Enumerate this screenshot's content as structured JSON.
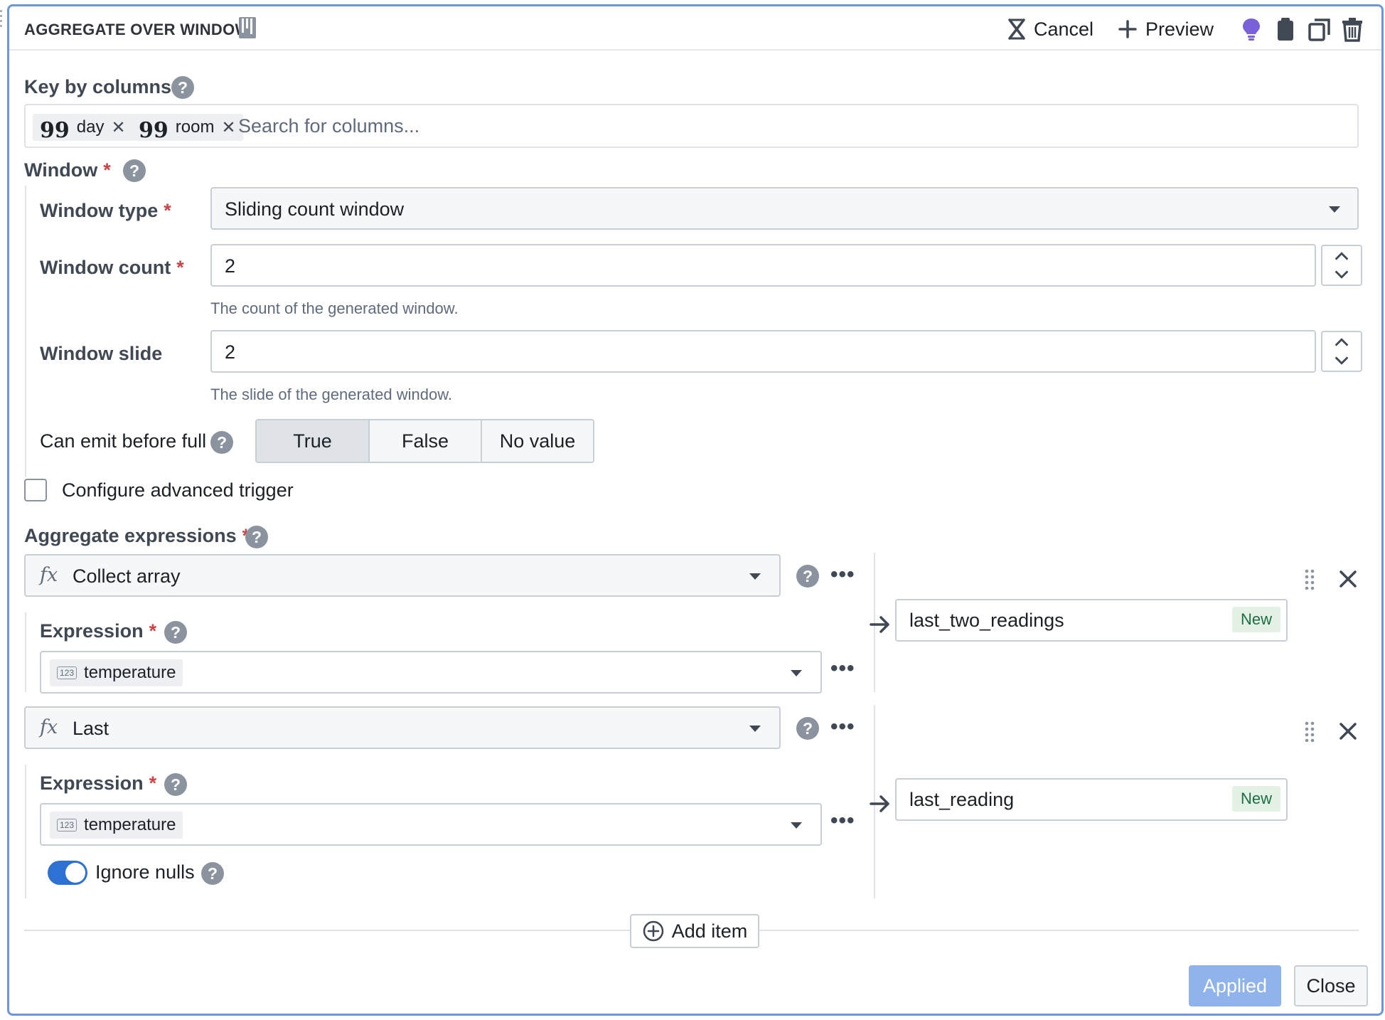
{
  "header": {
    "title": "AGGREGATE OVER WINDOW",
    "cancel_label": "Cancel",
    "preview_label": "Preview",
    "icons": [
      "doc-icon",
      "close-x-icon",
      "plus-icon",
      "lightbulb-icon",
      "clipboard-icon",
      "duplicate-icon",
      "trash-icon"
    ],
    "accent": "#7b61d9"
  },
  "key_by": {
    "label": "Key by columns",
    "tags": [
      "day",
      "room"
    ],
    "placeholder": "Search for columns..."
  },
  "window": {
    "label": "Window",
    "type_label": "Window type",
    "type_value": "Sliding count window",
    "count_label": "Window count",
    "count_value": "2",
    "count_hint": "The count of the generated window.",
    "slide_label": "Window slide",
    "slide_value": "2",
    "slide_hint": "The slide of the generated window.",
    "emit_label": "Can emit before full",
    "emit_options": [
      "True",
      "False",
      "No value"
    ],
    "emit_selected": "True"
  },
  "advanced_trigger": {
    "label": "Configure advanced trigger",
    "checked": false
  },
  "aggregates": {
    "label": "Aggregate expressions",
    "items": [
      {
        "function": "Collect array",
        "expr_label": "Expression",
        "column": "temperature",
        "column_type": "123",
        "output": "last_two_readings",
        "badge": "New"
      },
      {
        "function": "Last",
        "expr_label": "Expression",
        "column": "temperature",
        "column_type": "123",
        "output": "last_reading",
        "badge": "New",
        "ignore_nulls_label": "Ignore nulls",
        "ignore_nulls": true
      }
    ],
    "add_label": "Add item"
  },
  "footer": {
    "applied_label": "Applied",
    "close_label": "Close"
  },
  "colors": {
    "primary": "#2d72d2",
    "required": "#cd4246",
    "frame": "#6e97d8",
    "applied_bg": "#8fb3ea",
    "new_badge_bg": "#e3f2e5"
  }
}
